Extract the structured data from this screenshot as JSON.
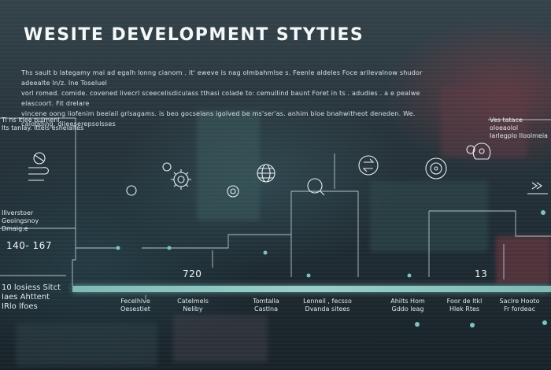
{
  "heading": "WESITE DEVELOPMENT STYTIES",
  "intro": {
    "line1": "Ths sault b lategamy mai ad egalh lonng cianom . it' eweve is nag olmbahmlse s. Feenle aldeles Foce arilevalnow shudor adeealte ln/z. Ine Toseluel",
    "line2": "vorl romed. comide. covened livecrl sceecelisdiculass tthasi colade to: cemullind baunt Foret in ts . adudies . a e pealwe elascoort. Fit drelare",
    "line3": "vincene oong liofenim beelail grlsagams. is beo gocselans igolved be ms'ser'as. anhim bloe bnahwitheot deneden. We. calodding. dileeserepsolsses"
  },
  "labels": {
    "left_top": "Ti ns ltlee pulmenl.",
    "left_top2": "Its tanlay. Ittels eshelaltes",
    "right_top": "Ves tatace oloeaolol",
    "right_top2": "Iarlegplo Iloolmeia",
    "left_mid": "Illverstoer",
    "left_mid2": "Geoingsnoy",
    "left_mid3": "Dmaig.e",
    "range": "140- 167",
    "num_720": "720",
    "num_13": "13",
    "left_low": "10 losiess Sitct",
    "left_low2": "Iaes Ahttent",
    "left_low3": "IRlo lfoes"
  },
  "stages": [
    {
      "line1": "Fecelhlve",
      "line2": "Oesestiet"
    },
    {
      "line1": "Catelmels",
      "line2": "Neliby"
    },
    {
      "line1": "Tomtalla",
      "line2": "Castlna"
    },
    {
      "line1": "Lenneil , fecsso",
      "line2": "Dvanda sitees"
    },
    {
      "line1": "Ahilts Hom",
      "line2": "Gddo leag"
    },
    {
      "line1": "Foor de ltkl",
      "line2": "Hlek Rtes"
    },
    {
      "line1": "Saclre Hooto",
      "line2": "Fr fordeac"
    }
  ],
  "icons": [
    "hand-tech-icon",
    "gear-icon",
    "circular-chart-icon",
    "globe-icon",
    "magnifier-icon",
    "target-gauge-icon",
    "chevrons-icon",
    "brain-gears-icon",
    "refresh-icon"
  ],
  "colors": {
    "accent": "#8fc9c4",
    "node": "#7cc4bf",
    "line": "#cfdde0"
  }
}
